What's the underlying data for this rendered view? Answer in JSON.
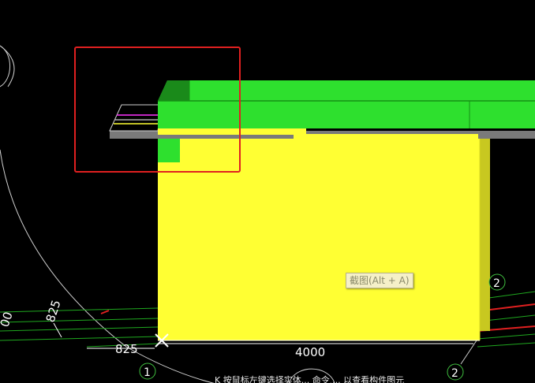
{
  "viewport": {
    "background": "#000000",
    "colors": {
      "beam": "#2ee02e",
      "beam_dark": "#1a8a1a",
      "column": "#ffff33",
      "slab": "#7a7a7a",
      "selection_box": "#e02020",
      "axis_circle": "#3fbf3f",
      "dimension_text": "#ffffff"
    }
  },
  "dimensions": {
    "dim_825_vertical": "825",
    "dim_825_horizontal": "825",
    "dim_4000": "4000",
    "dim_partial_left": "00"
  },
  "axis_markers": {
    "axis_1": "1",
    "axis_2_right": "2",
    "axis_2_bottom": "2"
  },
  "tooltip": {
    "text": "截图(Alt + A)"
  },
  "status_bar": {
    "hint": "K 按鼠标左键选择实体... 命令 ... 以查看构件图元"
  },
  "icons": {
    "insertion_marker": "x-cross-icon"
  }
}
